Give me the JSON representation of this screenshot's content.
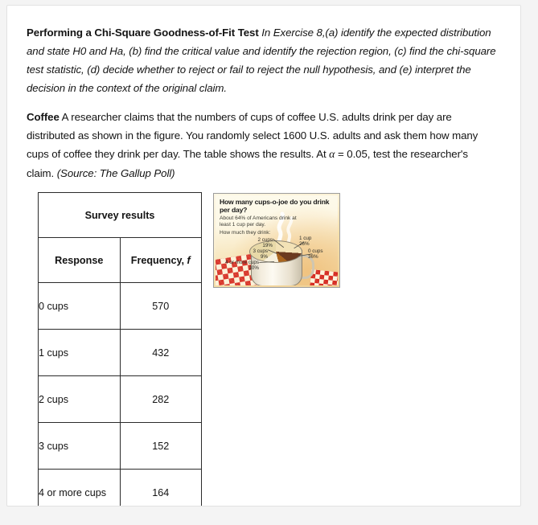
{
  "problem": {
    "intro": {
      "lead": "Performing a Chi-Square Goodness-of-Fit Test",
      "body_1": "In Exercise 8,(a) identify the expected distribution and state H0 and Ha, (b) find the critical value and identify the rejection region, (c) find the chi-square test statistic, (d) decide whether to reject or fail to reject the null hypothesis, and (e) interpret the decision in the context of the original claim."
    },
    "coffee": {
      "lead": "Coffee",
      "body_1": "A researcher claims that the numbers of cups of coffee U.S. adults drink per day are distributed as shown in the figure. You randomly select 1600 U.S. adults and ask them how many cups of coffee they drink per day. The table shows the results. At ",
      "alpha": "α",
      "body_2": " = 0.05, test the researcher's claim. ",
      "source": "(Source: The Gallup Poll)"
    }
  },
  "table": {
    "title": "Survey results",
    "headers": [
      "Response",
      "Frequency, f"
    ],
    "header_freq_prefix": "Frequency, ",
    "header_freq_symbol": "f",
    "rows": [
      {
        "response": "0 cups",
        "frequency": "570"
      },
      {
        "response": "1 cups",
        "frequency": "432"
      },
      {
        "response": "2 cups",
        "frequency": "282"
      },
      {
        "response": "3 cups",
        "frequency": "152"
      },
      {
        "response": "4 or more cups",
        "frequency": "164"
      }
    ]
  },
  "chart_data": {
    "type": "pie",
    "title": "How many cups-o-joe do you drink per day?",
    "subtitle": "About 64% of Americans drink at least 1 cup per day.",
    "prompt": "How much they drink:",
    "categories": [
      "0 cups",
      "1 cup",
      "2 cups",
      "3 cups",
      "4 or more cups"
    ],
    "values": [
      36,
      26,
      19,
      9,
      10
    ],
    "labels": [
      {
        "name": "0 cups",
        "value": "36%"
      },
      {
        "name": "1 cup",
        "value": "26%"
      },
      {
        "name": "2 cups",
        "value": "19%"
      },
      {
        "name": "3 cups",
        "value": "9%"
      },
      {
        "name": "4 or more cups",
        "value": "10%"
      }
    ],
    "legend": "none",
    "grid": false,
    "colors": [
      "#e8d9a8",
      "#f7f0dd",
      "#f3e2b6",
      "#6b3a1f",
      "#a9651f"
    ]
  }
}
